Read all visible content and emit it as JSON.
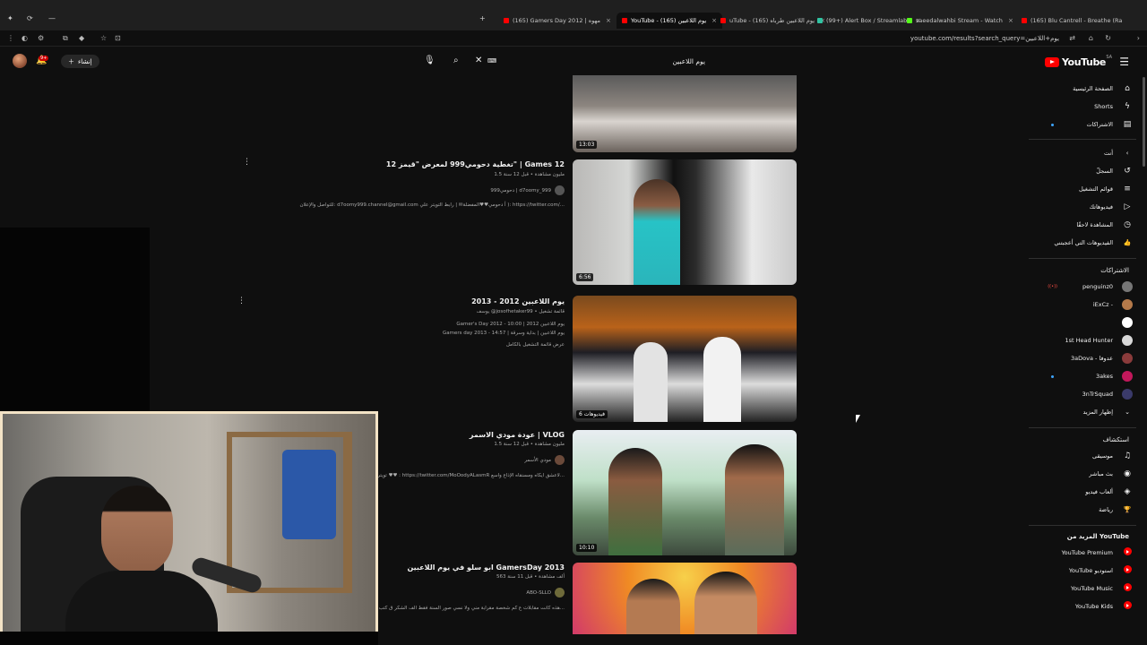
{
  "browser": {
    "tabs": [
      {
        "label": "(165) Gamers Day 2012 | مهوه",
        "fav": "#ff0000",
        "active": false
      },
      {
        "label": "YouTube - يوم اللاعبين (165)",
        "fav": "#ff0000",
        "active": true
      },
      {
        "label": "uTube - (165) يوم اللاعبين طرباه",
        "fav": "#ff0000",
        "active": false
      },
      {
        "label": "(99+) Alert Box / Streamlabs",
        "fav": "#31c3a2",
        "active": false
      },
      {
        "label": "saeedalwahbi Stream - Watch",
        "fav": "#53fc18",
        "active": false
      },
      {
        "label": "(165) Blu Cantrell - Breathe (Ra",
        "fav": "#ff0000",
        "active": false
      }
    ],
    "url": "youtube.com/results?search_query=يوم+اللاعبين"
  },
  "header": {
    "logo_text": "YouTube",
    "logo_country": "SA",
    "search_query": "يوم اللاعبين",
    "create_label": "إنشاء",
    "notif_count": "9+"
  },
  "sidebar": {
    "main": [
      {
        "label": "الصفحة الرئيسية",
        "icon": "⌂"
      },
      {
        "label": "Shorts",
        "icon": "ϟ"
      },
      {
        "label": "الاشتراكات",
        "icon": "▤"
      }
    ],
    "you_header": "أنت",
    "you": [
      {
        "label": "السجلّ",
        "icon": "↺"
      },
      {
        "label": "قوائم التشغيل",
        "icon": "≡"
      },
      {
        "label": "فيديوهاتك",
        "icon": "▷"
      },
      {
        "label": "المشاهدة لاحقًا",
        "icon": "◷"
      },
      {
        "label": "الفيديوهات التي أعجبتني",
        "icon": "👍"
      }
    ],
    "subs_header": "الاشتراكات",
    "subs": [
      {
        "label": "penguinz0",
        "color": "#777777"
      },
      {
        "label": "iExCz -",
        "color": "#b57a4a"
      },
      {
        "label": "",
        "color": "#ffffff"
      },
      {
        "label": "1st Head Hunter",
        "color": "#d8d8d8"
      },
      {
        "label": "3aDova - عدوفا",
        "color": "#8a3b3b"
      },
      {
        "label": "3akes",
        "color": "#c2185b"
      },
      {
        "label": "3nTrSquad",
        "color": "#3a3a6a"
      },
      {
        "label": "إظهار المزيد",
        "color": ""
      }
    ],
    "explore_header": "استكشاف",
    "explore": [
      {
        "label": "موسيقى",
        "icon": "♫"
      },
      {
        "label": "بث مباشر",
        "icon": "◉"
      },
      {
        "label": "ألعاب فيديو",
        "icon": "◈"
      },
      {
        "label": "رياضة",
        "icon": "🏆"
      }
    ],
    "more_header": "المزيد من YouTube",
    "more": [
      {
        "label": "YouTube Premium"
      },
      {
        "label": "YouTube استوديو"
      },
      {
        "label": "YouTube Music"
      },
      {
        "label": "YouTube Kids"
      }
    ]
  },
  "results": [
    {
      "duration": "13:03"
    },
    {
      "title": "تغطية دحومي999 لمعرض \"قيمز 12\" | Games 12",
      "meta": "1.5 مليون مشاهدة • قبل 12 سنة",
      "channel": "دحومي999 | d7oomy_999",
      "desc": "للتواصل والإعلان: d7oomy999.channel@gmail.com أ دحومي♥♥المفضلة✉ | رابط التويتر علي ): https://twitter.com/...",
      "duration": "6:56"
    },
    {
      "title": "يوم اللاعبين 2012 - 2013",
      "meta": "يوسف @josofhetaker99 • قائمة تشغيل",
      "lines": [
        "Gamer's Day 2012 - يوم اللاعبين 2012 | 10:00",
        "Gamers day 2013 - يوم اللاعبين | بداية وسرقة | 14:57"
      ],
      "desc": "عرض قائمة التشغيل بالكامل",
      "duration": "6 فيديوهات"
    },
    {
      "title": "عودة مودي الاسمر | VLOG",
      "meta": "1.5 مليون مشاهدة • قبل 12 سنة",
      "channel": "مودي الأسمر",
      "desc": "تويتر يحاني ♥♥ : https://twitter.com/MoOodyALasmR لاعشق ايكاه ومسنقاه الإذاع واسع...",
      "duration": "10:10"
    },
    {
      "title": "ابو سلو في يوم اللاعبين GamersDay 2013",
      "meta": "563 ألف مشاهدة • قبل 11 سنة",
      "channel": "ABO-SLLO",
      "desc": "هذه كانت مقابلات ع كم شخصة مقرابة مني ولا نسي صور السنة فقط الف الشكر ق كتب ♥ | رابط ابو سلو في الفو..."
    }
  ]
}
